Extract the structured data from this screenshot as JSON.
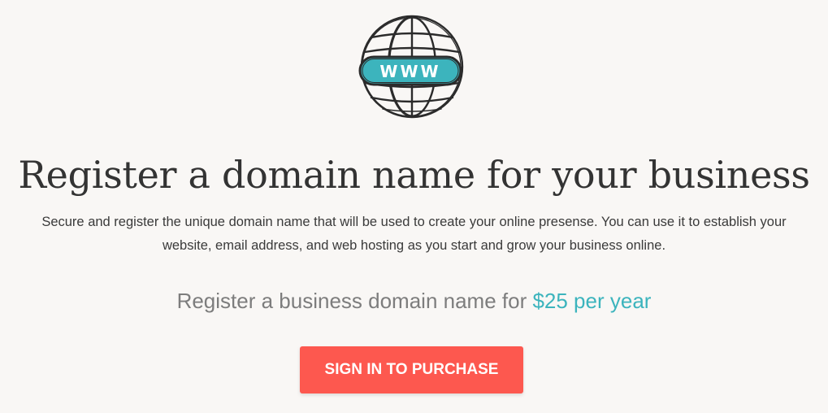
{
  "hero": {
    "logo_icon": "www-globe-icon",
    "logo_text": "WWW",
    "headline": "Register a domain name for your business",
    "description": "Secure and register the unique domain name that will be used to create your online presense. You can use it to establish your website, email address, and web hosting as you start and grow your business online.",
    "price_prefix": "Register a business domain name for ",
    "price_value": "$25 per year",
    "cta_label": "SIGN IN TO PURCHASE"
  },
  "colors": {
    "background": "#f9f7f5",
    "accent": "#3cb4bd",
    "cta": "#fd584f",
    "heading": "#333333",
    "muted": "#7d7d7d"
  }
}
